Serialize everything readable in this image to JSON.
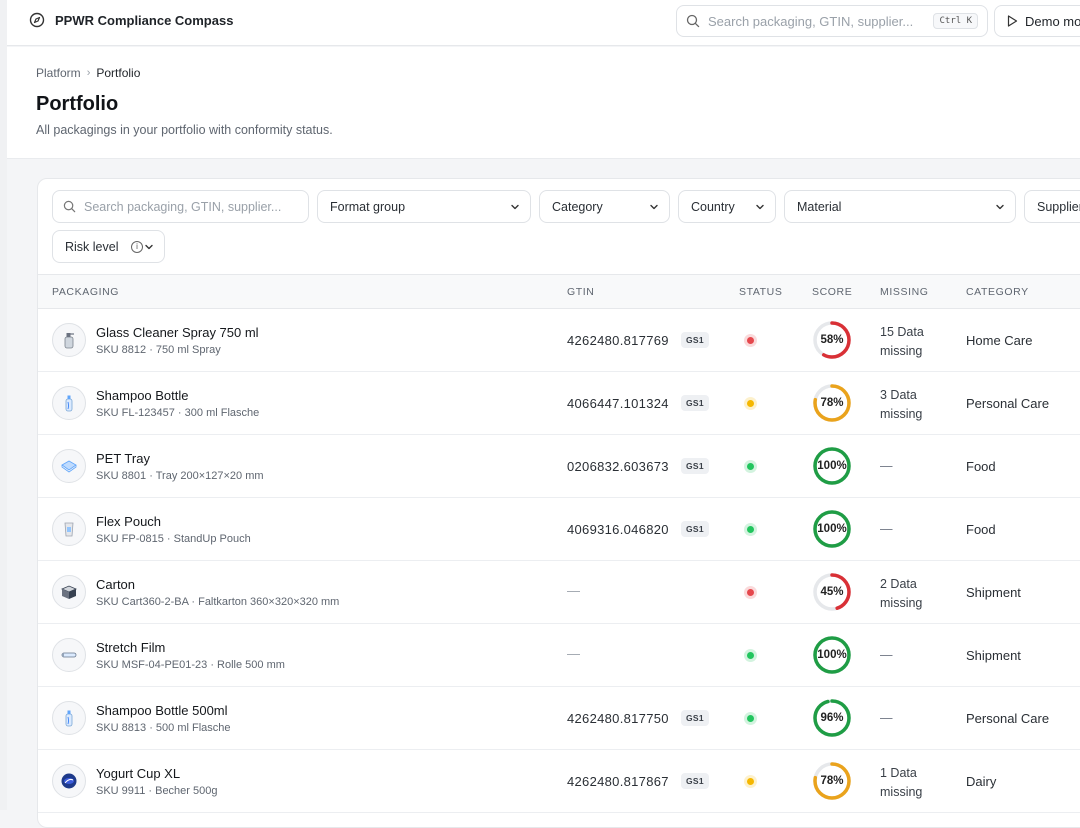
{
  "app": {
    "title": "PPWR Compliance Compass"
  },
  "topbar": {
    "search_placeholder": "Search packaging, GTIN, supplier...",
    "shortcut": "Ctrl K",
    "demo_label": "Demo mode"
  },
  "breadcrumb": {
    "root": "Platform",
    "current": "Portfolio"
  },
  "header": {
    "title": "Portfolio",
    "subtitle": "All packagings in your portfolio with conformity status."
  },
  "filters": {
    "search_placeholder": "Search packaging, GTIN, supplier...",
    "format_group": "Format group",
    "category": "Category",
    "country": "Country",
    "material": "Material",
    "supplier": "Supplier",
    "risk_level": "Risk level"
  },
  "table": {
    "columns": {
      "packaging": "PACKAGING",
      "gtin": "GTIN",
      "status": "STATUS",
      "score": "SCORE",
      "missing": "MISSING",
      "category": "CATEGORY"
    },
    "gs1_label": "GS1",
    "empty": "—",
    "rows": [
      {
        "name": "Glass Cleaner Spray 750 ml",
        "sku": "SKU 8812 · 750 ml Spray",
        "gtin": "4262480.817769",
        "status": "red",
        "score": 58,
        "score_label": "58%",
        "missing_l1": "15 Data",
        "missing_l2": "missing",
        "category": "Home Care",
        "icon": "spray-bottle-icon"
      },
      {
        "name": "Shampoo Bottle",
        "sku": "SKU FL-123457 · 300 ml Flasche",
        "gtin": "4066447.101324",
        "status": "yellow",
        "score": 78,
        "score_label": "78%",
        "missing_l1": "3 Data",
        "missing_l2": "missing",
        "category": "Personal Care",
        "icon": "bottle-icon"
      },
      {
        "name": "PET Tray",
        "sku": "SKU 8801 · Tray 200×127×20 mm",
        "gtin": "0206832.603673",
        "status": "green",
        "score": 100,
        "score_label": "100%",
        "missing_l1": "—",
        "missing_l2": "",
        "category": "Food",
        "icon": "tray-icon"
      },
      {
        "name": "Flex Pouch",
        "sku": "SKU FP-0815 · StandUp Pouch",
        "gtin": "4069316.046820",
        "status": "green",
        "score": 100,
        "score_label": "100%",
        "missing_l1": "—",
        "missing_l2": "",
        "category": "Food",
        "icon": "pouch-icon"
      },
      {
        "name": "Carton",
        "sku": "SKU Cart360-2-BA · Faltkarton 360×320×320 mm",
        "gtin": "",
        "status": "red",
        "score": 45,
        "score_label": "45%",
        "missing_l1": "2 Data",
        "missing_l2": "missing",
        "category": "Shipment",
        "icon": "carton-icon"
      },
      {
        "name": "Stretch Film",
        "sku": "SKU MSF-04-PE01-23 · Rolle 500 mm",
        "gtin": "",
        "status": "green",
        "score": 100,
        "score_label": "100%",
        "missing_l1": "—",
        "missing_l2": "",
        "category": "Shipment",
        "icon": "film-roll-icon"
      },
      {
        "name": "Shampoo Bottle 500ml",
        "sku": "SKU 8813 · 500 ml Flasche",
        "gtin": "4262480.817750",
        "status": "green",
        "score": 96,
        "score_label": "96%",
        "missing_l1": "—",
        "missing_l2": "",
        "category": "Personal Care",
        "icon": "bottle-icon"
      },
      {
        "name": "Yogurt Cup XL",
        "sku": "SKU 9911 · Becher 500g",
        "gtin": "4262480.817867",
        "status": "yellow",
        "score": 78,
        "score_label": "78%",
        "missing_l1": "1 Data",
        "missing_l2": "missing",
        "category": "Dairy",
        "icon": "cup-icon"
      }
    ]
  },
  "colors": {
    "red": "#e5484d",
    "yellow": "#f5b700",
    "green": "#22c55e",
    "ring_red": "#d93036",
    "ring_yellow": "#eaa31c",
    "ring_green": "#1f9d45",
    "ring_track": "#e6e8eb"
  }
}
